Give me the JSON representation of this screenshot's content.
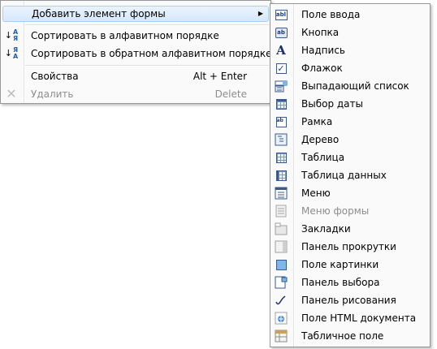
{
  "context_menu": {
    "items": [
      {
        "label": "Добавить элемент формы",
        "arrow": "▶",
        "highlighted": true
      },
      {
        "label": "Сортировать в алфавитном порядке"
      },
      {
        "label": "Сортировать в обратном алфавитном порядке"
      },
      {
        "label": "Свойства",
        "shortcut": "Alt + Enter"
      },
      {
        "label": "Удалить",
        "shortcut": "Delete",
        "disabled": true
      }
    ],
    "sort_icon_glyphs": {
      "a": "А",
      "ya": "Я",
      "arrow": "↓"
    }
  },
  "submenu": {
    "items": [
      {
        "label": "Поле ввода",
        "icon": "textbox-icon"
      },
      {
        "label": "Кнопка",
        "icon": "button-icon"
      },
      {
        "label": "Надпись",
        "icon": "label-icon"
      },
      {
        "label": "Флажок",
        "icon": "checkbox-icon"
      },
      {
        "label": "Выпадающий список",
        "icon": "dropdown-icon"
      },
      {
        "label": "Выбор даты",
        "icon": "calendar-icon"
      },
      {
        "label": "Рамка",
        "icon": "frame-icon"
      },
      {
        "label": "Дерево",
        "icon": "tree-icon"
      },
      {
        "label": "Таблица",
        "icon": "table-icon"
      },
      {
        "label": "Таблица данных",
        "icon": "datatable-icon"
      },
      {
        "label": "Меню",
        "icon": "menu-icon"
      },
      {
        "label": "Меню формы",
        "icon": "form-menu-icon",
        "disabled": true
      },
      {
        "label": "Закладки",
        "icon": "tabs-icon"
      },
      {
        "label": "Панель прокрутки",
        "icon": "scrollbar-icon"
      },
      {
        "label": "Поле картинки",
        "icon": "picture-icon"
      },
      {
        "label": "Панель выбора",
        "icon": "selection-panel-icon"
      },
      {
        "label": "Панель рисования",
        "icon": "drawing-icon"
      },
      {
        "label": "Поле HTML документа",
        "icon": "html-field-icon"
      },
      {
        "label": "Табличное поле",
        "icon": "spreadsheet-icon"
      }
    ],
    "icon_texts": {
      "textbox": "abl",
      "button": "ab",
      "label": "A",
      "checkbox": "✓",
      "frame": "ab"
    }
  },
  "colors": {
    "highlight": "#d7e8fc",
    "disabled_text": "#8d8d8d",
    "icon_blue": "#3b5a8c"
  }
}
